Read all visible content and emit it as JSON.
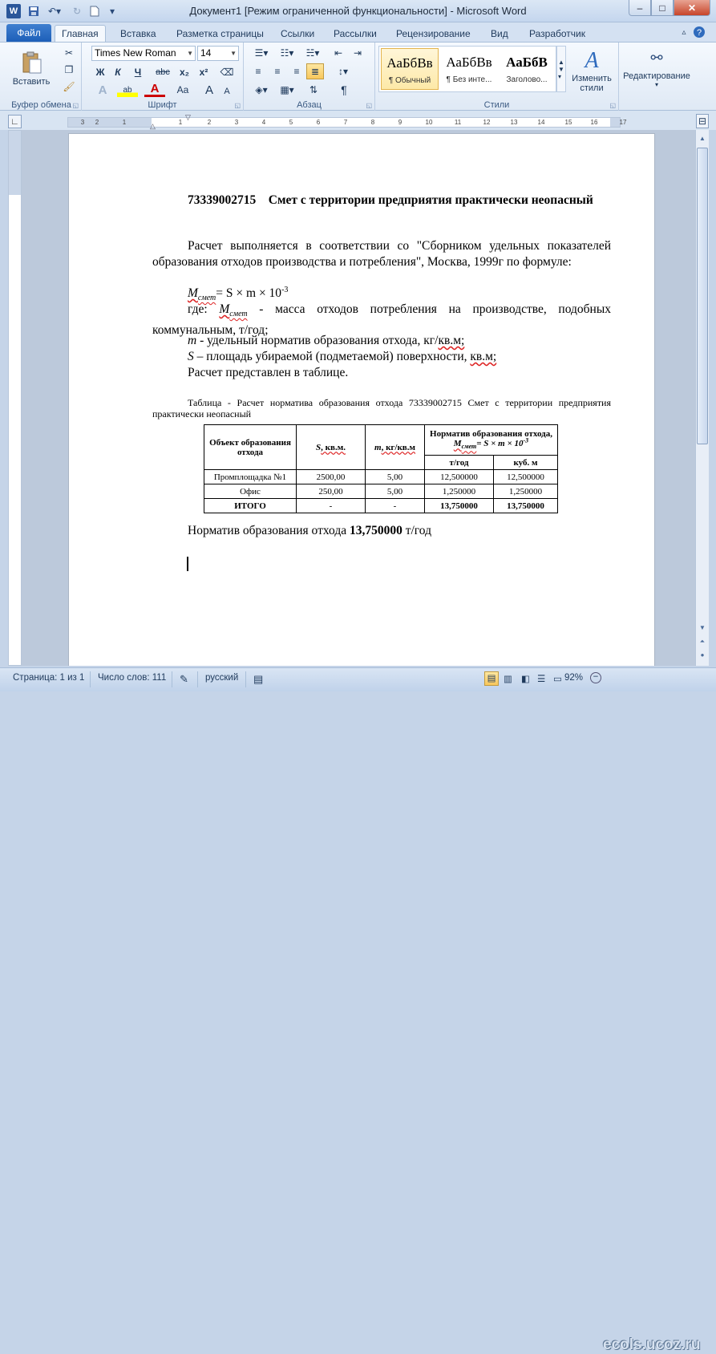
{
  "window": {
    "title": "Документ1 [Режим ограниченной функциональности]  -  Microsoft Word",
    "logo": "W",
    "min": "–",
    "max": "□",
    "close": "✕"
  },
  "tabs": [
    "Файл",
    "Главная",
    "Вставка",
    "Разметка страницы",
    "Ссылки",
    "Рассылки",
    "Рецензирование",
    "Вид",
    "Разработчик"
  ],
  "ribbon": {
    "paste_label": "Вставить",
    "clipboard_group": "Буфер обмена",
    "font_group": "Шрифт",
    "paragraph_group": "Абзац",
    "styles_group": "Стили",
    "font_name": "Times New Roman",
    "font_size": "14",
    "bold": "Ж",
    "italic": "К",
    "underline": "Ч",
    "strike": "abc",
    "sub": "x₂",
    "sup": "x²",
    "change_case": "Aa",
    "grow": "A",
    "shrink": "A",
    "styles": [
      {
        "preview": "АаБбВв",
        "name": "¶ Обычный"
      },
      {
        "preview": "АаБбВв",
        "name": "¶ Без инте..."
      },
      {
        "preview": "АаБбВ",
        "name": "Заголово..."
      }
    ],
    "change_styles": "Изменить стили",
    "editing": "Редактирование"
  },
  "ruler_ticks": [
    "3",
    "1",
    "2",
    "1",
    "1",
    "2",
    "3",
    "4",
    "5",
    "6",
    "7",
    "8",
    "9",
    "10",
    "11",
    "12",
    "13",
    "14",
    "15",
    "16",
    "17"
  ],
  "document": {
    "heading_code": "73339002715",
    "heading_rest": "Смет с территории предприятия практически неопасный",
    "p1": "Расчет выполняется в соответствии со \"Сборником удельных показателей образования отходов производства и потребления\", Москва, 1999г  по формуле:",
    "formula_M": "М",
    "formula_sub": "смет",
    "formula_rest": "=  S × m × 10",
    "formula_exp": "-3",
    "where_lead": "где: ",
    "where_M": "М",
    "where_sub": "смет",
    "where_rest": " - масса отходов потребления на производстве, подобных коммунальным, т/год;",
    "m_var": "m",
    "m_text": " -  удельный норматив образования отхода, кг/",
    "m_unit": "кв.м;",
    "s_var": "S",
    "s_text": " – площадь убираемой (подметаемой) поверхности, ",
    "s_unit": "кв.м;",
    "p_table": "Расчет представлен в таблице.",
    "caption": "Таблица - Расчет норматива образования отхода 73339002715 Смет с территории предприятия практически неопасный",
    "result_lead": "Норматив образования отхода ",
    "result_value": "13,750000",
    "result_unit": " т/год"
  },
  "table": {
    "h_object": "Объект образования отхода",
    "h_s": "S",
    "h_s_unit": ", кв.м.",
    "h_m": "m",
    "h_m_unit": ", кг/кв.м",
    "h_norm": "Норматив образования отхода,",
    "h_norm_M": "М",
    "h_norm_sub": "смет",
    "h_norm_formula": "=  S × m × 10",
    "h_norm_exp": "-3",
    "h_tyear": "т/год",
    "h_cubm": "куб. м",
    "rows": [
      {
        "obj": "Промплощадка №1",
        "s": "2500,00",
        "m": "5,00",
        "t": "12,500000",
        "c": "12,500000"
      },
      {
        "obj": "Офис",
        "s": "250,00",
        "m": "5,00",
        "t": "1,250000",
        "c": "1,250000"
      },
      {
        "obj": "ИТОГО",
        "s": "-",
        "m": "-",
        "t": "13,750000",
        "c": "13,750000"
      }
    ]
  },
  "status": {
    "page": "Страница: 1 из 1",
    "words": "Число слов: 111",
    "lang": "русский",
    "zoom": "92%",
    "watermark": "ecols.ucoz.ru"
  }
}
